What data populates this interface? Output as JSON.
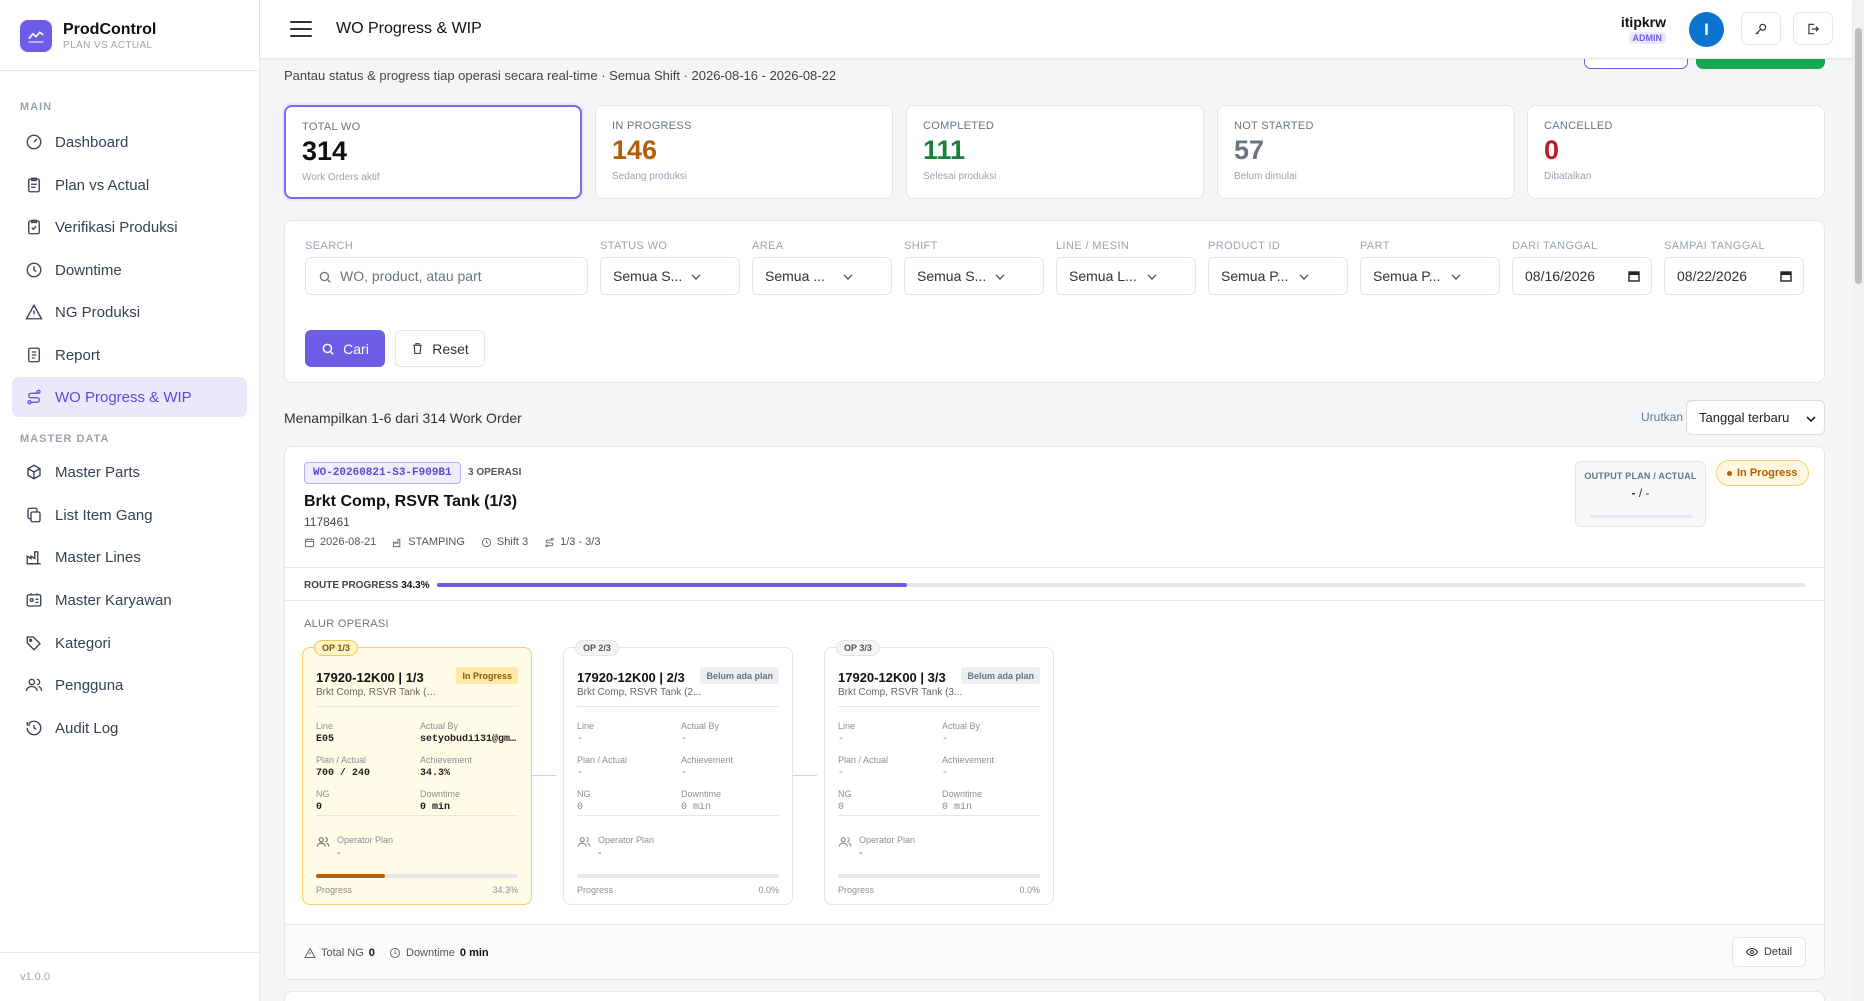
{
  "brand": {
    "name": "ProdControl",
    "subtitle": "PLAN VS ACTUAL",
    "version": "v1.0.0"
  },
  "sidebar": {
    "main_title": "MAIN",
    "master_title": "MASTER DATA",
    "main_items": [
      {
        "label": "Dashboard",
        "icon": "gauge-icon"
      },
      {
        "label": "Plan vs Actual",
        "icon": "clipboard-icon"
      },
      {
        "label": "Verifikasi Produksi",
        "icon": "clipboard-check-icon"
      },
      {
        "label": "Downtime",
        "icon": "clock-icon"
      },
      {
        "label": "NG Produksi",
        "icon": "warning-icon"
      },
      {
        "label": "Report",
        "icon": "report-icon"
      },
      {
        "label": "WO Progress & WIP",
        "icon": "route-icon",
        "active": true
      }
    ],
    "master_items": [
      {
        "label": "Master Parts",
        "icon": "box-icon"
      },
      {
        "label": "List Item Gang",
        "icon": "copy-icon"
      },
      {
        "label": "Master Lines",
        "icon": "factory-icon"
      },
      {
        "label": "Master Karyawan",
        "icon": "id-card-icon"
      },
      {
        "label": "Kategori",
        "icon": "tags-icon"
      },
      {
        "label": "Pengguna",
        "icon": "users-icon"
      },
      {
        "label": "Audit Log",
        "icon": "history-icon"
      }
    ]
  },
  "header": {
    "title": "WO Progress & WIP",
    "user": "itipkrw",
    "role": "ADMIN",
    "avatar_initial": "I",
    "colors": {
      "accent": "#6e5ce6",
      "avatar": "#0b74d1"
    }
  },
  "subtitle": "Pantau status & progress tiap operasi secara real-time · Semua Shift · 2026-08-16 - 2026-08-22",
  "stats": [
    {
      "label": "TOTAL WO",
      "value": "314",
      "sub": "Work Orders aktif",
      "color": "#111111"
    },
    {
      "label": "IN PROGRESS",
      "value": "146",
      "sub": "Sedang produksi",
      "color": "#b45e0a"
    },
    {
      "label": "COMPLETED",
      "value": "111",
      "sub": "Selesai produksi",
      "color": "#16803c"
    },
    {
      "label": "NOT STARTED",
      "value": "57",
      "sub": "Belum dimulai",
      "color": "#6b7280"
    },
    {
      "label": "CANCELLED",
      "value": "0",
      "sub": "Dibatalkan",
      "color": "#c0192b"
    }
  ],
  "filters": {
    "search": {
      "label": "SEARCH",
      "placeholder": "WO, product, atau part"
    },
    "status": {
      "label": "STATUS WO",
      "value": "Semua S..."
    },
    "area": {
      "label": "AREA",
      "value": "Semua ..."
    },
    "shift": {
      "label": "SHIFT",
      "value": "Semua S..."
    },
    "line": {
      "label": "LINE / MESIN",
      "value": "Semua L..."
    },
    "product": {
      "label": "PRODUCT ID",
      "value": "Semua P..."
    },
    "part": {
      "label": "PART",
      "value": "Semua P..."
    },
    "from": {
      "label": "DARI TANGGAL",
      "value": "08/16/2026"
    },
    "to": {
      "label": "SAMPAI TANGGAL",
      "value": "08/22/2026"
    },
    "cari_label": "Cari",
    "reset_label": "Reset"
  },
  "results": {
    "text": "Menampilkan 1-6 dari 314 Work Order",
    "sort_label": "Urutkan",
    "sort_value": "Tanggal terbaru"
  },
  "wo": {
    "id": "WO-20260821-S3-F909B1",
    "op_count": "3 OPERASI",
    "title": "Brkt Comp, RSVR Tank (1/3)",
    "product_id": "1178461",
    "date": "2026-08-21",
    "area": "STAMPING",
    "shift": "Shift 3",
    "route": "1/3 - 3/3",
    "output_label": "OUTPUT PLAN / ACTUAL",
    "output_plan": "-",
    "output_actual": "-",
    "status": "In Progress",
    "route_progress_label": "ROUTE PROGRESS",
    "route_progress_pct": "34.3%",
    "route_progress_value": 34.3,
    "alur_label": "ALUR OPERASI",
    "operations": [
      {
        "tag": "OP 1/3",
        "name": "17920-12K00 | 1/3",
        "desc": "Brkt Comp, RSVR Tank (1/3)",
        "badge": "In Progress",
        "state": "active",
        "line_label": "Line",
        "line": "E05",
        "actual_by_label": "Actual By",
        "actual_by": "setyobudi131@gma...",
        "plan_actual_label": "Plan / Actual",
        "plan_actual": "700 / 240",
        "achievement_label": "Achievement",
        "achievement": "34.3%",
        "ng_label": "NG",
        "ng": "0",
        "downtime_label": "Downtime",
        "downtime": "0 min",
        "operator_label": "Operator Plan",
        "operator": "-",
        "progress_label": "Progress",
        "progress_pct": "34.3%",
        "progress_value": 34.3
      },
      {
        "tag": "OP 2/3",
        "name": "17920-12K00 | 2/3",
        "desc": "Brkt Comp, RSVR Tank (2...",
        "badge": "Belum ada plan",
        "state": "pending",
        "line_label": "Line",
        "line": "-",
        "actual_by_label": "Actual By",
        "actual_by": "-",
        "plan_actual_label": "Plan / Actual",
        "plan_actual": "-",
        "achievement_label": "Achievement",
        "achievement": "-",
        "ng_label": "NG",
        "ng": "0",
        "downtime_label": "Downtime",
        "downtime": "0 min",
        "operator_label": "Operator Plan",
        "operator": "-",
        "progress_label": "Progress",
        "progress_pct": "0.0%",
        "progress_value": 0
      },
      {
        "tag": "OP 3/3",
        "name": "17920-12K00 | 3/3",
        "desc": "Brkt Comp, RSVR Tank (3...",
        "badge": "Belum ada plan",
        "state": "pending",
        "line_label": "Line",
        "line": "-",
        "actual_by_label": "Actual By",
        "actual_by": "-",
        "plan_actual_label": "Plan / Actual",
        "plan_actual": "-",
        "achievement_label": "Achievement",
        "achievement": "-",
        "ng_label": "NG",
        "ng": "0",
        "downtime_label": "Downtime",
        "downtime": "0 min",
        "operator_label": "Operator Plan",
        "operator": "-",
        "progress_label": "Progress",
        "progress_pct": "0.0%",
        "progress_value": 0
      }
    ],
    "total_ng_label": "Total NG",
    "total_ng": "0",
    "downtime_label": "Downtime",
    "downtime": "0 min",
    "detail_label": "Detail"
  }
}
